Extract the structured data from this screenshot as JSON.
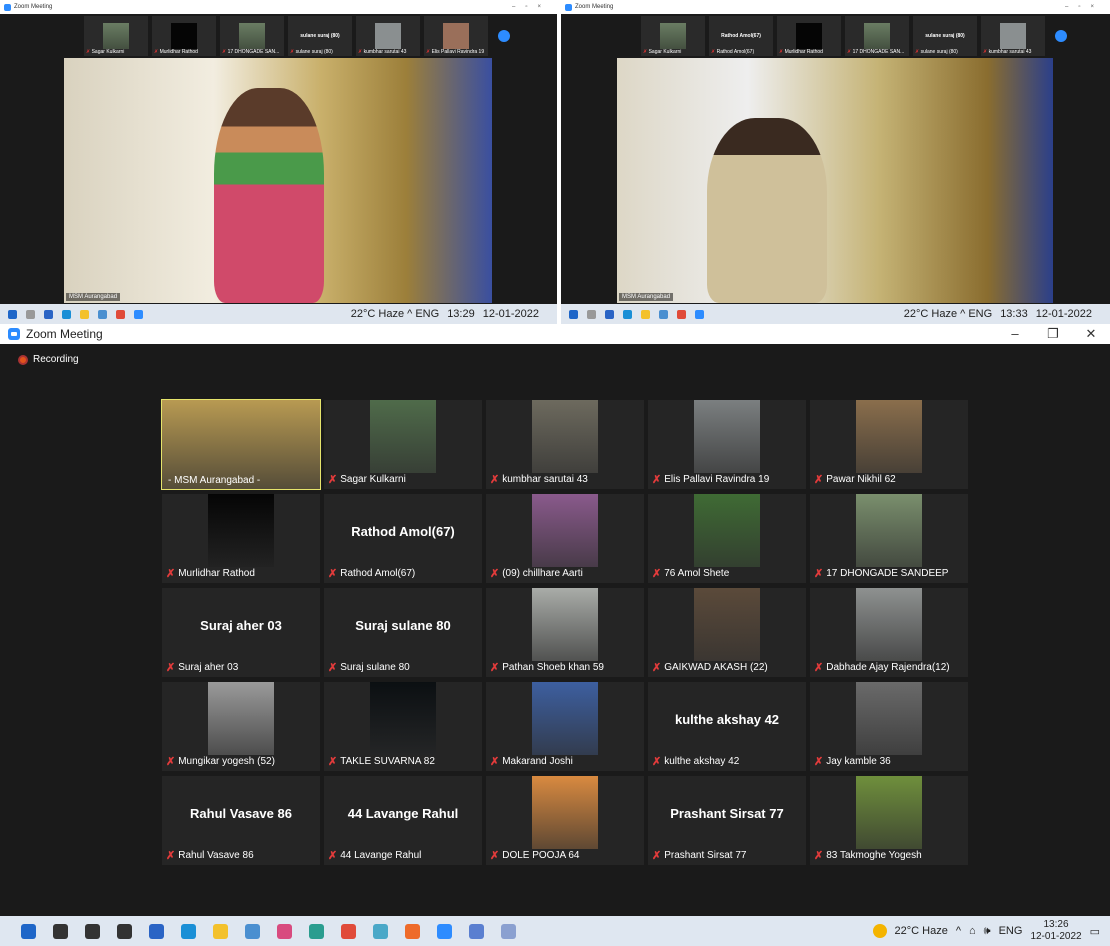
{
  "mini_left": {
    "title": "Zoom Meeting",
    "thumbs": [
      "Sagar Kulkarni",
      "Murlidhar Rathod",
      "17 DHONGADE SAN...",
      "sulane suraj (80)",
      "kumbhar sarutai 43",
      "Elis Pallavi Ravindra 19"
    ],
    "thumb_center_label": "sulane suraj (80)",
    "video_label": "MSM Aurangabad",
    "tray": "22°C Haze  ^  ENG",
    "clock_time": "13:29",
    "clock_date": "12-01-2022"
  },
  "mini_right": {
    "title": "Zoom Meeting",
    "thumbs": [
      "Sagar Kulkarni",
      "Rathod Amol(67)",
      "Murlidhar Rathod",
      "17 DHONGADE SAN...",
      "sulane suraj (80)",
      "kumbhar sarutai 43"
    ],
    "thumb_center_label_1": "Rathod Amol(67)",
    "thumb_center_label_2": "sulane suraj (80)",
    "video_label": "MSM Aurangabad",
    "tray": "22°C Haze  ^  ENG",
    "clock_time": "13:33",
    "clock_date": "12-01-2022"
  },
  "window": {
    "title": "Zoom Meeting",
    "recording": "Recording"
  },
  "participants": [
    {
      "name": "- MSM Aurangabad -",
      "type": "video",
      "active": true,
      "muted": false,
      "color": "#b89a52"
    },
    {
      "name": "Sagar Kulkarni",
      "type": "video",
      "muted": true,
      "color": "#4f6b4a"
    },
    {
      "name": "kumbhar sarutai 43",
      "type": "video",
      "muted": true,
      "color": "#6d6a5e"
    },
    {
      "name": "Elis Pallavi Ravindra 19",
      "type": "video",
      "muted": true,
      "color": "#7b7f80"
    },
    {
      "name": "Pawar Nikhil 62",
      "type": "video",
      "muted": true,
      "color": "#8a6e4c"
    },
    {
      "name": "Murlidhar Rathod",
      "type": "video",
      "muted": true,
      "color": "#050505"
    },
    {
      "name": "Rathod Amol(67)",
      "type": "text",
      "muted": true
    },
    {
      "name": "(09) chillhare Aarti",
      "type": "video",
      "muted": true,
      "color": "#8a5a8c"
    },
    {
      "name": "76 Amol Shete",
      "type": "video",
      "muted": true,
      "color": "#3f6b34"
    },
    {
      "name": "17 DHONGADE SANDEEP",
      "type": "video",
      "muted": true,
      "color": "#7a8f6d"
    },
    {
      "name": "Suraj aher 03",
      "type": "text",
      "muted": true
    },
    {
      "name": "Suraj sulane 80",
      "type": "text",
      "muted": true
    },
    {
      "name": "Pathan Shoeb khan 59",
      "type": "video",
      "muted": true,
      "color": "#a9aca8"
    },
    {
      "name": "GAIKWAD AKASH (22)",
      "type": "video",
      "muted": true,
      "color": "#5b4a3a"
    },
    {
      "name": "Dabhade Ajay Rajendra(12)",
      "type": "video",
      "muted": true,
      "color": "#8e9190"
    },
    {
      "name": "Mungikar yogesh (52)",
      "type": "video",
      "muted": true,
      "color": "#9a9a9a"
    },
    {
      "name": "TAKLE SUVARNA 82",
      "type": "video",
      "muted": true,
      "color": "#0b0f12"
    },
    {
      "name": "Makarand Joshi",
      "type": "video",
      "muted": true,
      "color": "#3d5fa0"
    },
    {
      "name": "kulthe akshay 42",
      "type": "text",
      "muted": true
    },
    {
      "name": "Jay kamble 36",
      "type": "video",
      "muted": true,
      "color": "#6a6a6a"
    },
    {
      "name": "Rahul Vasave  86",
      "type": "text",
      "muted": true
    },
    {
      "name": "44 Lavange Rahul",
      "type": "text",
      "muted": true
    },
    {
      "name": "DOLE POOJA 64",
      "type": "video",
      "muted": true,
      "color": "#d98a40"
    },
    {
      "name": "Prashant Sirsat 77",
      "type": "text",
      "muted": true
    },
    {
      "name": "83 Takmoghe Yogesh",
      "type": "video",
      "muted": true,
      "color": "#6f8f3c"
    }
  ],
  "taskbar": {
    "weather": "22°C  Haze",
    "lang": "ENG",
    "time": "13:26",
    "date": "12-01-2022",
    "icons": [
      "windows-icon",
      "search-icon",
      "cortana-icon",
      "task-view-icon",
      "store-icon",
      "edge-icon",
      "explorer-icon",
      "app-l-icon",
      "app-p-icon",
      "app-boat-icon",
      "chrome-icon",
      "app-teal-icon",
      "app-orange-icon",
      "zoom-icon",
      "app-doc-icon",
      "app-pen-icon"
    ],
    "icon_colors": [
      "#1e66c8",
      "#333",
      "#333",
      "#333",
      "#2a64c5",
      "#1a8fd6",
      "#f3c12c",
      "#4a8fd0",
      "#d84b7f",
      "#2a9d8f",
      "#e04b3a",
      "#4aa8c8",
      "#ee6b2a",
      "#2d8cff",
      "#5a7fd0",
      "#8aa0d0"
    ]
  }
}
